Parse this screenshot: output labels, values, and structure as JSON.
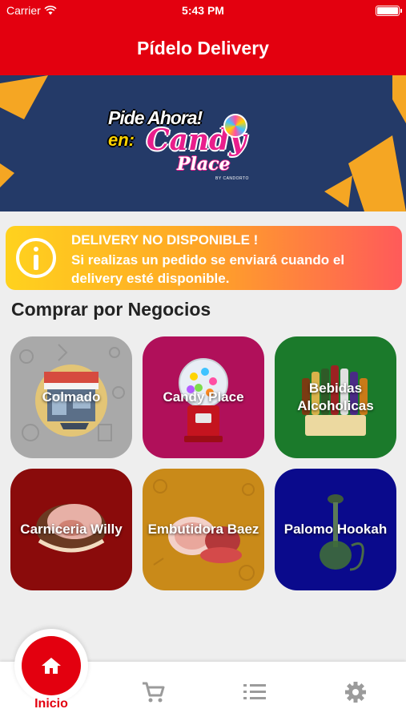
{
  "status_bar": {
    "carrier": "Carrier",
    "time": "5:43 PM"
  },
  "header": {
    "title": "Pídelo Delivery"
  },
  "banner": {
    "line1": "Pide Ahora!",
    "line2": "en:",
    "brand_top": "Candy",
    "brand_bottom": "Place",
    "byline": "BY CANDORTO"
  },
  "alert": {
    "title": "DELIVERY NO DISPONIBLE !",
    "message": "Si realizas un pedido se enviará cuando el delivery esté disponible.",
    "icon": "info-icon"
  },
  "section": {
    "title": "Comprar por Negocios"
  },
  "categories": [
    {
      "label": "Colmado",
      "color": "#a9a9a9",
      "icon": "storefront-icon"
    },
    {
      "label": "Candy Place",
      "color": "#b0105a",
      "icon": "gumball-machine-icon"
    },
    {
      "label": "Bebidas Alcoholicas",
      "color": "#1b7a2b",
      "icon": "bottles-icon"
    },
    {
      "label": "Carniceria Willy",
      "color": "#8a0b0b",
      "icon": "meat-icon"
    },
    {
      "label": "Embutidora Baez",
      "color": "#c98a19",
      "icon": "sausage-icon"
    },
    {
      "label": "Palomo Hookah",
      "color": "#0a0a8c",
      "icon": "hookah-icon"
    }
  ],
  "bottom_nav": {
    "home_label": "Inicio",
    "items": [
      "home-icon",
      "cart-icon",
      "list-icon",
      "gear-icon"
    ]
  },
  "colors": {
    "primary": "#e3000f",
    "banner_bg": "#243a68",
    "accent_orange": "#f5a623"
  }
}
